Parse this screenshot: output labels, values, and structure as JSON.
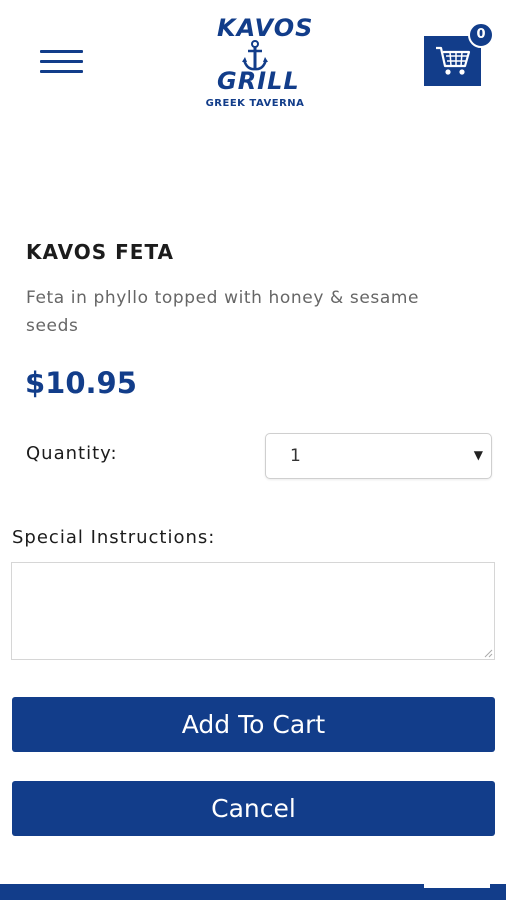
{
  "brand": {
    "name_line1": "KAVOS",
    "name_line2": "GRILL",
    "tagline": "GREEK TAVERNA",
    "accent_color": "#123d8a"
  },
  "header": {
    "menu_icon": "hamburger-menu-icon",
    "cart_icon": "shopping-cart-icon",
    "cart_count": "0"
  },
  "product": {
    "title": "KAVOS FETA",
    "description": "Feta in phyllo topped with honey & sesame seeds",
    "price": "$10.95"
  },
  "form": {
    "quantity_label": "Quantity:",
    "quantity_value": "1",
    "instructions_label": "Special Instructions:",
    "instructions_value": ""
  },
  "actions": {
    "add_to_cart": "Add To Cart",
    "cancel": "Cancel"
  }
}
